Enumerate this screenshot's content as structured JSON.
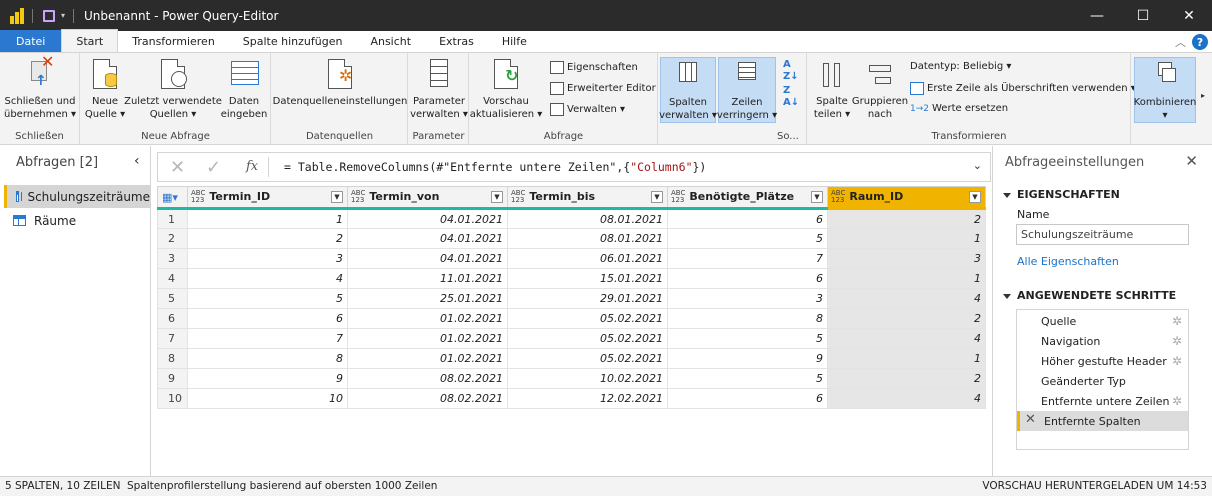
{
  "window": {
    "title": "Unbenannt - Power Query-Editor"
  },
  "tabs": [
    "Datei",
    "Start",
    "Transformieren",
    "Spalte hinzufügen",
    "Ansicht",
    "Extras",
    "Hilfe"
  ],
  "help_label": "?",
  "ribbon": {
    "close_apply": {
      "label1": "Schließen und",
      "label2": "übernehmen ▾"
    },
    "group_close": "Schließen",
    "new_source": {
      "label1": "Neue",
      "label2": "Quelle ▾"
    },
    "recent_sources": {
      "label1": "Zuletzt verwendete",
      "label2": "Quellen ▾"
    },
    "enter_data": {
      "label1": "Daten",
      "label2": "eingeben"
    },
    "group_new_query": "Neue Abfrage",
    "ds_settings": {
      "label1": "Datenquelleneinstellungen"
    },
    "group_datasources": "Datenquellen",
    "params": {
      "label1": "Parameter",
      "label2": "verwalten ▾"
    },
    "group_params": "Parameter",
    "refresh": {
      "label1": "Vorschau",
      "label2": "aktualisieren ▾"
    },
    "properties": "Eigenschaften",
    "adv_editor": "Erweiterter Editor",
    "manage": "Verwalten ▾",
    "group_query": "Abfrage",
    "manage_cols": {
      "label1": "Spalten",
      "label2": "verwalten ▾"
    },
    "reduce_rows": {
      "label1": "Zeilen",
      "label2": "verringern ▾"
    },
    "group_sort": "So...",
    "split_col": {
      "label1": "Spalte",
      "label2": "teilen ▾"
    },
    "group_by": {
      "label1": "Gruppieren",
      "label2": "nach"
    },
    "datatype": "Datentyp: Beliebig ▾",
    "first_row_header": "Erste Zeile als Überschriften verwenden ▾",
    "replace_values": "Werte ersetzen",
    "group_transform": "Transformieren",
    "combine": {
      "label1": "Kombinieren",
      "label2": "▾"
    }
  },
  "queries": {
    "header": "Abfragen [2]",
    "items": [
      "Schulungszeiträume",
      "Räume"
    ]
  },
  "formula": {
    "prefix": "= Table.RemoveColumns(#\"Entfernte untere Zeilen\",{",
    "string": "\"Column6\"",
    "suffix": "})"
  },
  "table": {
    "columns": [
      "Termin_ID",
      "Termin_von",
      "Termin_bis",
      "Benötigte_Plätze",
      "Raum_ID"
    ],
    "type_label_top": "ABC",
    "type_label_bottom": "123",
    "rows": [
      [
        "1",
        "1",
        "04.01.2021",
        "08.01.2021",
        "6",
        "2"
      ],
      [
        "2",
        "2",
        "04.01.2021",
        "08.01.2021",
        "5",
        "1"
      ],
      [
        "3",
        "3",
        "04.01.2021",
        "06.01.2021",
        "7",
        "3"
      ],
      [
        "4",
        "4",
        "11.01.2021",
        "15.01.2021",
        "6",
        "1"
      ],
      [
        "5",
        "5",
        "25.01.2021",
        "29.01.2021",
        "3",
        "4"
      ],
      [
        "6",
        "6",
        "01.02.2021",
        "05.02.2021",
        "8",
        "2"
      ],
      [
        "7",
        "7",
        "01.02.2021",
        "05.02.2021",
        "5",
        "4"
      ],
      [
        "8",
        "8",
        "01.02.2021",
        "05.02.2021",
        "9",
        "1"
      ],
      [
        "9",
        "9",
        "08.02.2021",
        "10.02.2021",
        "5",
        "2"
      ],
      [
        "10",
        "10",
        "08.02.2021",
        "12.02.2021",
        "6",
        "4"
      ]
    ]
  },
  "settings": {
    "header": "Abfrageeinstellungen",
    "properties_title": "EIGENSCHAFTEN",
    "name_label": "Name",
    "name_value": "Schulungszeiträume",
    "all_props": "Alle Eigenschaften",
    "steps_title": "ANGEWENDETE SCHRITTE",
    "steps": [
      "Quelle",
      "Navigation",
      "Höher gestufte Header",
      "Geänderter Typ",
      "Entfernte untere Zeilen",
      "Entfernte Spalten"
    ]
  },
  "status": {
    "left": "5 SPALTEN, 10 ZEILEN",
    "profile": "Spaltenprofilerstellung basierend auf obersten 1000 Zeilen",
    "right": "VORSCHAU HERUNTERGELADEN UM 14:53"
  }
}
